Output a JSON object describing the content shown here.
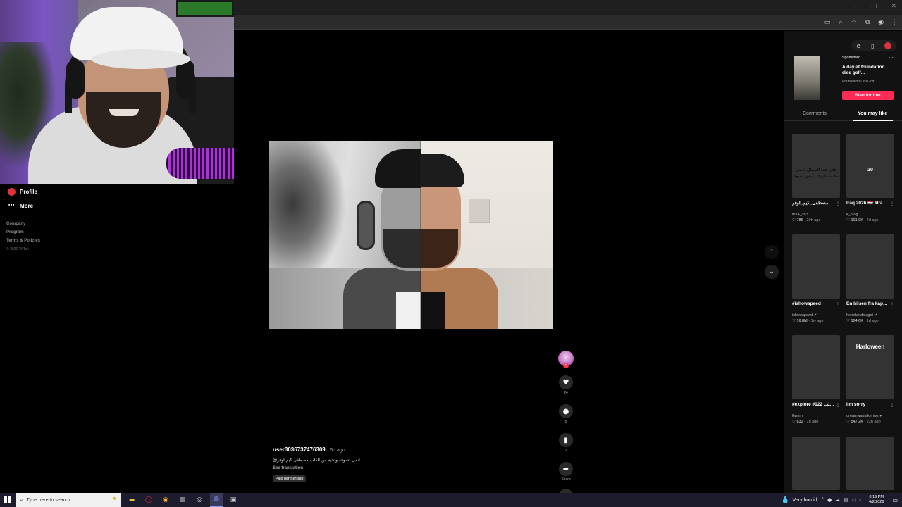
{
  "browser": {
    "window_controls": [
      "–",
      "▢",
      "✕"
    ],
    "toolbar_icons": [
      "cast-icon",
      "zoom-icon",
      "bookmark-star-icon",
      "extensions-icon",
      "profile-icon",
      "menu-icon"
    ]
  },
  "sidebar": {
    "items": [
      {
        "label": "Profile",
        "icon": "avatar-icon"
      },
      {
        "label": "More",
        "icon": "dots-icon"
      }
    ],
    "footer": [
      "Company",
      "Program",
      "Terms & Policies"
    ],
    "copyright": "© 2026 TikTok"
  },
  "video": {
    "counts": {
      "likes": "24",
      "comments": "5",
      "saves": "1"
    },
    "share_label": "Share"
  },
  "caption": {
    "username": "user3036737476309",
    "ago": "· 5d ago",
    "description": "@انمى تشوفه وتحيه من القلب مصطفى كيم اوفر",
    "see_translation": "See translation",
    "badge": "Paid partnership"
  },
  "right_panel": {
    "ad": {
      "sponsored": "Sponsored",
      "title": "A day at foundation disc golf...",
      "brand": "Foundation DiscGolf",
      "cta": "Start for free"
    },
    "tabs": {
      "comments": "Comments",
      "you_may_like": "You may like"
    },
    "cards": [
      {
        "title": "شير هذا الجمال 🖤🖤 #مصطفى_كيم_اوفر...",
        "author": "m14_zo3",
        "likes": "786",
        "ago": "20h ago",
        "thumb_text": "على هذا الجمال اجمل ما جه غيرك يلبس اسود"
      },
      {
        "title": "Iraq 2026 🇮🇶 #Iraq #foryou #viral...",
        "author": "k_8.og",
        "likes": "101.9K",
        "ago": "4d ago",
        "thumb_text": "20"
      },
      {
        "title": "#ishowspeed",
        "author": "ishowspeed ✔",
        "likes": "16.8M",
        "ago": "1w ago",
        "thumb_text": ""
      },
      {
        "title": "En hilsen fra kapteinene 🤝 See...",
        "author": "herrelandslaget ✔",
        "likes": "164.6K",
        "ago": "1d ago",
        "thumb_text": ""
      },
      {
        "title": "#explore #الامارات #مقلب 122#",
        "author": "8vmm",
        "likes": "832",
        "ago": "1d ago",
        "thumb_text": ""
      },
      {
        "title": "I'm sorry",
        "author": "dreamwastakenws ✔",
        "likes": "547.2K",
        "ago": "22h ago",
        "thumb_text": "Harloween"
      },
      {
        "title": "",
        "author": "",
        "likes": "",
        "ago": "",
        "thumb_text": ""
      },
      {
        "title": "",
        "author": "",
        "likes": "",
        "ago": "",
        "thumb_text": ""
      }
    ]
  },
  "taskbar": {
    "search_placeholder": "Type here to search",
    "weather": "Very humid",
    "time": "8:19 PM",
    "date": "4/2/2026",
    "apps": [
      "file-explorer-icon",
      "opera-icon",
      "chrome-icon",
      "calculator-icon",
      "obs-icon",
      "discord-icon",
      "terminal-icon"
    ]
  }
}
